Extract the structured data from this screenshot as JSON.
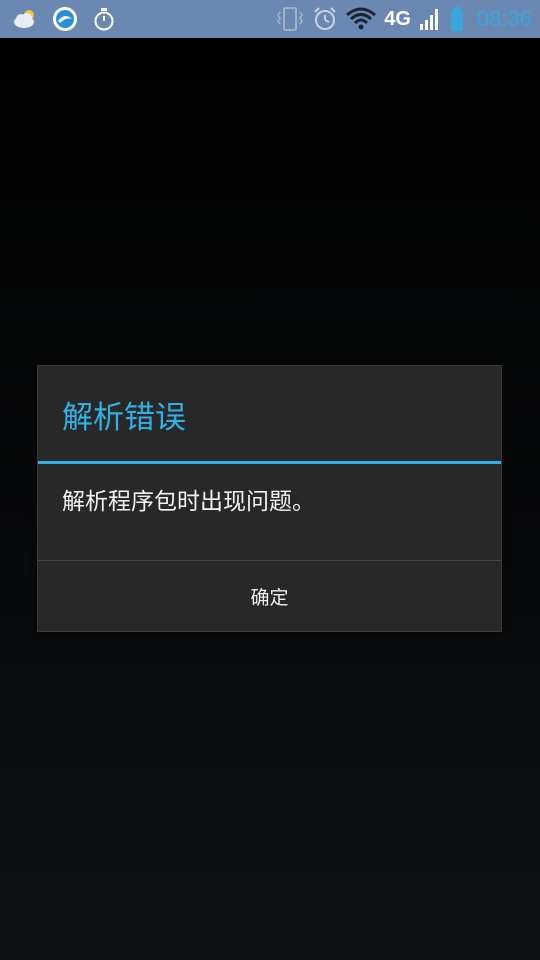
{
  "status_bar": {
    "left_icons": [
      "weather-cloud-icon",
      "browser-icon",
      "stopwatch-icon"
    ],
    "right_icons": [
      "vibrate-icon",
      "alarm-icon",
      "wifi-icon",
      "signal-icon",
      "battery-icon"
    ],
    "network_type": "4G",
    "time": "08:36",
    "background_color": "#6b88b3",
    "clock_color": "#3aa6de"
  },
  "dialog": {
    "title": "解析错误",
    "message": "解析程序包时出现问题。",
    "ok_button_label": "确定",
    "accent_color": "#33b0e3",
    "background_color": "#282828"
  }
}
